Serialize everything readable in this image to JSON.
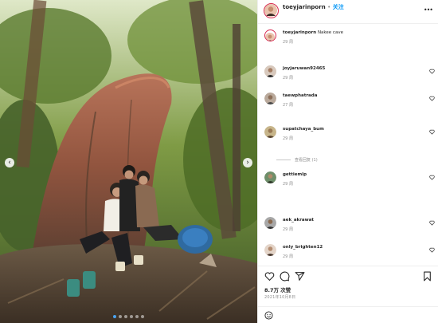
{
  "post": {
    "username": "toeyjarinporn",
    "follow_label": "关注",
    "location": "",
    "caption_text": "Nakee cave",
    "caption_time": "29 周"
  },
  "comments": [
    {
      "user": "joyjaruwan92465",
      "text": "",
      "meta": "29 周"
    },
    {
      "user": "taewphatrada",
      "text": "",
      "meta": "27 周"
    },
    {
      "user": "supatchaya_bum",
      "text": "",
      "meta": "29 周"
    },
    {
      "user": "gettiemlp",
      "text": "",
      "meta": "29 周"
    },
    {
      "user": "aek_akrawat",
      "text": "",
      "meta": "29 周"
    },
    {
      "user": "only_brighten12",
      "text": "",
      "meta": "29 周"
    }
  ],
  "replies_label": "查看回复 (1)",
  "likes": "8.7万 次赞",
  "date": "2021年10月8日",
  "add_comment_placeholder": "",
  "post_button": "",
  "colors": {
    "accent": "#0095f6",
    "ring": "#d8294f",
    "like_red": "#ed4956",
    "post_disabled": "#b2dffc"
  },
  "icons": [
    "heart-icon",
    "comment-icon",
    "share-icon",
    "bookmark-icon",
    "emoji-icon",
    "more-icon",
    "chevron-left-icon",
    "chevron-right-icon"
  ],
  "carousel": {
    "count": 6,
    "active": 1
  }
}
